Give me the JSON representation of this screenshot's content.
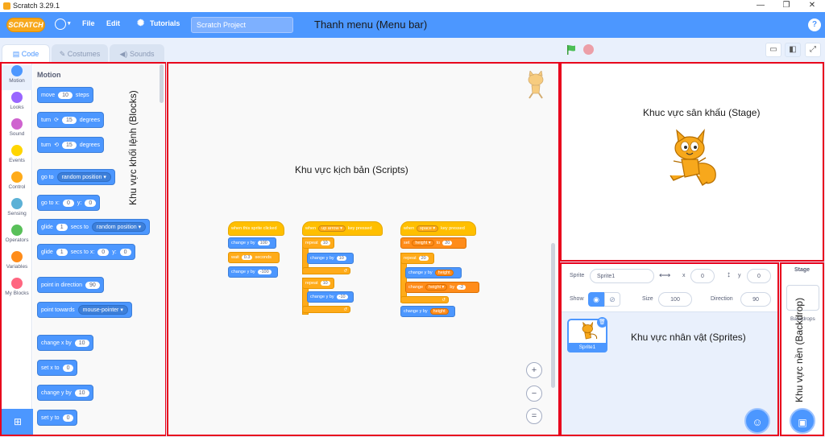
{
  "window": {
    "title": "Scratch 3.29.1",
    "min": "—",
    "max": "❐",
    "close": "✕"
  },
  "menubar": {
    "logo": "SCRATCH",
    "file": "File",
    "edit": "Edit",
    "tutorials": "Tutorials",
    "project_title": "Scratch Project",
    "annotation": "Thanh menu (Menu bar)",
    "help": "?"
  },
  "tabs": [
    {
      "label": "Code",
      "icon": "code-icon"
    },
    {
      "label": "Costumes",
      "icon": "brush-icon"
    },
    {
      "label": "Sounds",
      "icon": "speaker-icon"
    }
  ],
  "categories": [
    {
      "label": "Motion",
      "color": "#4c97ff"
    },
    {
      "label": "Looks",
      "color": "#9966ff"
    },
    {
      "label": "Sound",
      "color": "#cf63cf"
    },
    {
      "label": "Events",
      "color": "#ffd500"
    },
    {
      "label": "Control",
      "color": "#ffab19"
    },
    {
      "label": "Sensing",
      "color": "#5cb1d6"
    },
    {
      "label": "Operators",
      "color": "#59c059"
    },
    {
      "label": "Variables",
      "color": "#ff8c1a"
    },
    {
      "label": "My Blocks",
      "color": "#ff6680"
    }
  ],
  "palette": {
    "heading": "Motion",
    "annotation": "Khu vực khối lệnh (Blocks)",
    "move": {
      "a": "move",
      "v": "10",
      "b": "steps"
    },
    "turn_right": {
      "a": "turn",
      "icon": "⟳",
      "v": "15",
      "b": "degrees"
    },
    "turn_left": {
      "a": "turn",
      "icon": "⟲",
      "v": "15",
      "b": "degrees"
    },
    "goto": {
      "a": "go to",
      "opt": "random position ▾"
    },
    "goto_xy": {
      "a": "go to x:",
      "x": "0",
      "b": "y:",
      "y": "0"
    },
    "glide_to": {
      "a": "glide",
      "v": "1",
      "b": "secs to",
      "opt": "random position ▾"
    },
    "glide_xy": {
      "a": "glide",
      "v": "1",
      "b": "secs to x:",
      "x": "0",
      "c": "y:",
      "y": "0"
    },
    "point_dir": {
      "a": "point in direction",
      "v": "90"
    },
    "point_towards": {
      "a": "point towards",
      "opt": "mouse-pointer ▾"
    },
    "change_x": {
      "a": "change x by",
      "v": "10"
    },
    "set_x": {
      "a": "set x to",
      "v": "0"
    },
    "change_y": {
      "a": "change y by",
      "v": "10"
    },
    "set_y": {
      "a": "set y to",
      "v": "0"
    }
  },
  "scripts": {
    "annotation": "Khu vực kịch bản (Scripts)",
    "s1": {
      "hat": "when this sprite clicked",
      "b1": {
        "a": "change y by",
        "v": "100"
      },
      "b2": {
        "a": "wait",
        "v": "0.3",
        "b": "seconds"
      },
      "b3": {
        "a": "change y by",
        "v": "-100"
      }
    },
    "s2": {
      "hat": {
        "a": "when",
        "opt": "up arrow ▾",
        "b": "key pressed"
      },
      "r1": {
        "a": "repeat",
        "v": "10"
      },
      "r1b": {
        "a": "change y by",
        "v": "10"
      },
      "r2": {
        "a": "repeat",
        "v": "10"
      },
      "r2b": {
        "a": "change y by",
        "v": "-10"
      }
    },
    "s3": {
      "hat": {
        "a": "when",
        "opt": "space ▾",
        "b": "key pressed"
      },
      "set": {
        "a": "set",
        "opt": "height ▾",
        "b": "to",
        "v": "20"
      },
      "rep": {
        "a": "repeat",
        "v": "20"
      },
      "b1": {
        "a": "change y by",
        "var": "height"
      },
      "b2": {
        "a": "change",
        "opt": "height ▾",
        "b": "by",
        "v": "-2"
      },
      "b3": {
        "a": "change y by",
        "var": "height"
      }
    },
    "zoom_in": "+",
    "zoom_out": "−",
    "zoom_reset": "="
  },
  "stage": {
    "annotation": "Khuc vực sân khấu (Stage)"
  },
  "sprite_info": {
    "sprite_label": "Sprite",
    "sprite_name": "Sprite1",
    "x_label": "x",
    "x": "0",
    "y_label": "y",
    "y": "0",
    "show_label": "Show",
    "size_label": "Size",
    "size": "100",
    "direction_label": "Direction",
    "direction": "90"
  },
  "sprites": {
    "thumb_label": "Sprite1",
    "annotation": "Khu vực nhân vật (Sprites)"
  },
  "backdrop": {
    "title": "Stage",
    "backdrops_label": "Backdrops",
    "annotation": "Khu vực nền (Backdrop)"
  }
}
